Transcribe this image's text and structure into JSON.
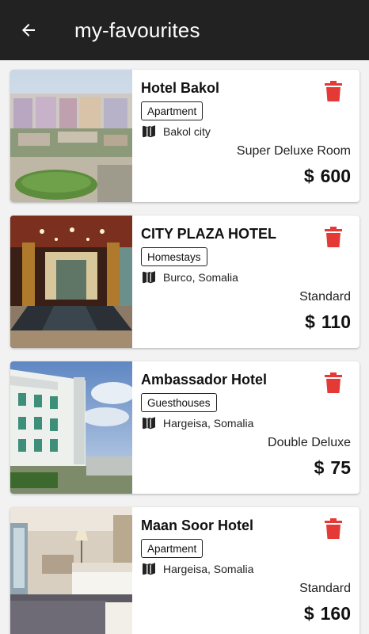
{
  "app_bar": {
    "title": "my-favourites",
    "background": "#222222",
    "back_icon": "arrow-left-icon"
  },
  "accent_delete_color": "#e53935",
  "favourites": [
    {
      "name": "Hotel Bakol",
      "type": "Apartment",
      "location": "Bakol city",
      "room": "Super Deluxe Room",
      "currency": "$",
      "price": "600",
      "image": "aerial view of town with roundabout"
    },
    {
      "name": "CITY PLAZA HOTEL",
      "type": "Homestays",
      "location": "Burco, Somalia",
      "room": "Standard",
      "currency": "$",
      "price": "110",
      "image": "hotel lobby entrance with columns"
    },
    {
      "name": "Ambassador Hotel",
      "type": "Guesthouses",
      "location": "Hargeisa, Somalia",
      "room": "Double Deluxe",
      "currency": "$",
      "price": "75",
      "image": "white hotel building with blue sky"
    },
    {
      "name": "Maan Soor Hotel",
      "type": "Apartment",
      "location": "Hargeisa, Somalia",
      "room": "Standard",
      "currency": "$",
      "price": "160",
      "image": "hotel bedroom with beds and lamp"
    }
  ]
}
